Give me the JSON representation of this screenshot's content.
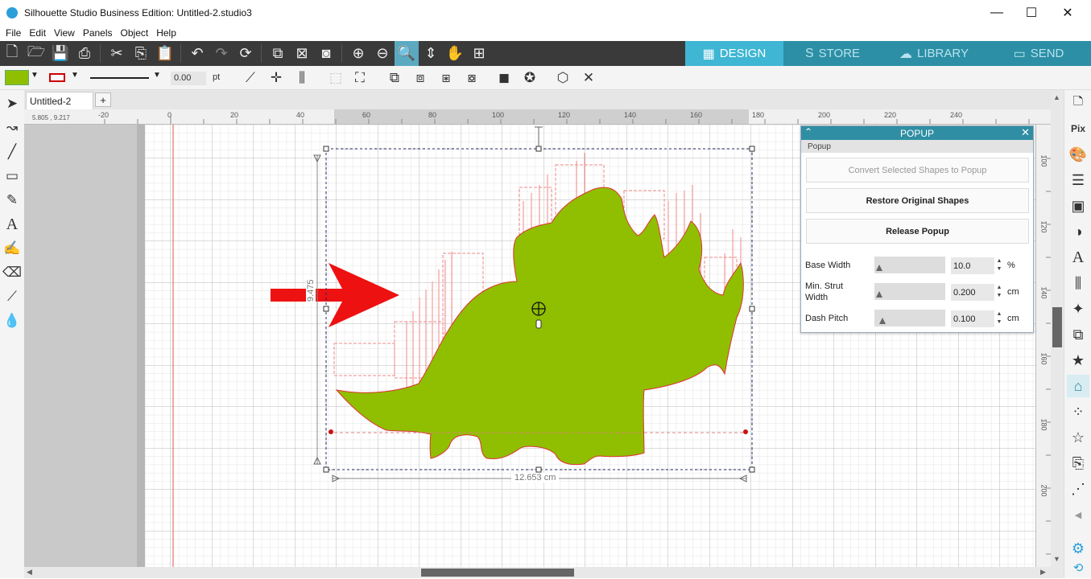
{
  "window": {
    "title": "Silhouette Studio Business Edition: Untitled-2.studio3",
    "minimize": "—",
    "maximize": "☐",
    "close": "✕"
  },
  "menu": [
    "File",
    "Edit",
    "View",
    "Panels",
    "Object",
    "Help"
  ],
  "tabs": [
    {
      "label": "DESIGN",
      "icon": "▦"
    },
    {
      "label": "STORE",
      "icon": "S"
    },
    {
      "label": "LIBRARY",
      "icon": "☁"
    },
    {
      "label": "SEND",
      "icon": "▭"
    }
  ],
  "toolbar2": {
    "fill_color": "#8fbf00",
    "line_color": "#cc0000",
    "line_width": "0.00",
    "line_unit": "pt"
  },
  "document": {
    "tab_name": "Untitled-2",
    "add_tab": "+",
    "cursor_coords": "5.805 , 9.217"
  },
  "ruler_top": [
    "-20",
    "0",
    "20",
    "40",
    "60",
    "80",
    "100",
    "120",
    "140",
    "160",
    "180",
    "200",
    "220",
    "240"
  ],
  "ruler_right": [
    "100",
    "120",
    "140",
    "160",
    "180",
    "200"
  ],
  "dimensions": {
    "width": "12.653 cm",
    "height": "9.475"
  },
  "colors": {
    "shape_fill": "#8fbf00",
    "shape_stroke": "#d33",
    "arrow": "#ee1111",
    "accent": "#2f8ea3"
  },
  "popup_panel": {
    "title": "POPUP",
    "subheader": "Popup",
    "collapse_icon": "⌃",
    "close_icon": "✕",
    "convert_button": "Convert Selected Shapes to Popup",
    "restore_button": "Restore Original Shapes",
    "release_button": "Release Popup",
    "fields": [
      {
        "label": "Base Width",
        "value": "10.0",
        "unit": "%"
      },
      {
        "label": "Min. Strut Width",
        "value": "0.200",
        "unit": "cm"
      },
      {
        "label": "Dash Pitch",
        "value": "0.100",
        "unit": "cm"
      }
    ]
  }
}
